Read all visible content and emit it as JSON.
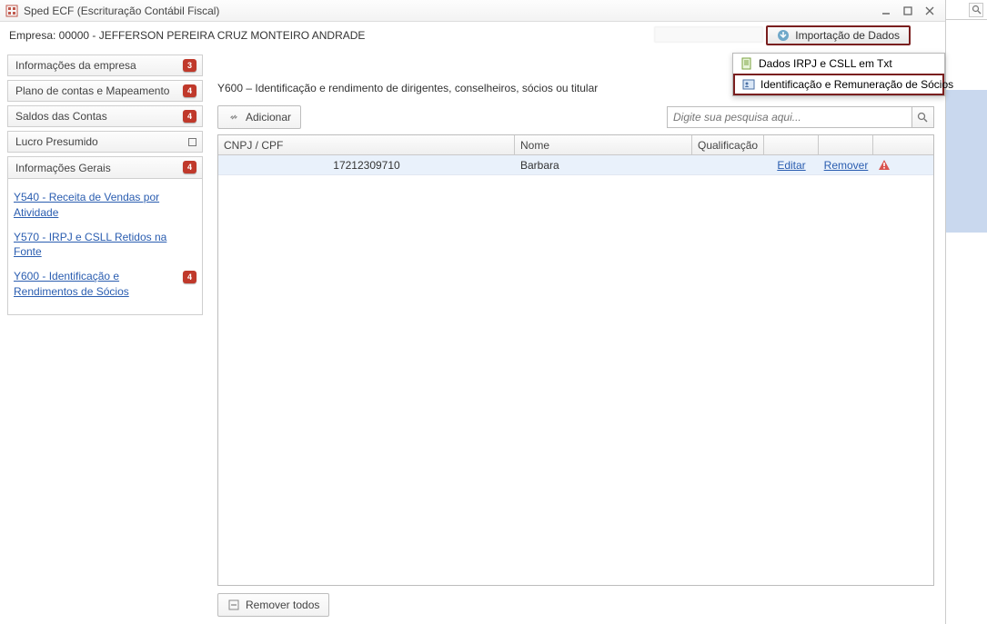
{
  "title": "Sped ECF (Escrituração Contábil Fiscal)",
  "company": "Empresa: 00000 - JEFFERSON PEREIRA CRUZ MONTEIRO ANDRADE",
  "import_button": "Importação de Dados",
  "dropdown": {
    "item1": "Dados IRPJ e CSLL em Txt",
    "item2": "Identificação e Remuneração de Sócios"
  },
  "sidebar": {
    "p1": {
      "label": "Informações da empresa",
      "badge": "3"
    },
    "p2": {
      "label": "Plano de contas e Mapeamento",
      "badge": "4"
    },
    "p3": {
      "label": "Saldos das Contas",
      "badge": "4"
    },
    "p4": {
      "label": "Lucro Presumido"
    },
    "p5": {
      "label": "Informações Gerais",
      "badge": "4"
    },
    "links": {
      "l1": "Y540 - Receita de Vendas por Atividade",
      "l2": "Y570 - IRPJ e CSLL Retidos na Fonte",
      "l3": "Y600 - Identificação e Rendimentos de Sócios",
      "l3_badge": "4"
    }
  },
  "main": {
    "heading": "Y600 – Identificação e rendimento de dirigentes, conselheiros, sócios ou titular",
    "add": "Adicionar",
    "search_placeholder": "Digite sua pesquisa aqui...",
    "remove_all": "Remover todos"
  },
  "table": {
    "cols": {
      "c1": "CNPJ / CPF",
      "c2": "Nome",
      "c3": "Qualificação"
    },
    "row0": {
      "cnpj": "17212309710",
      "nome": "Barbara",
      "editar": "Editar",
      "remover": "Remover"
    }
  }
}
